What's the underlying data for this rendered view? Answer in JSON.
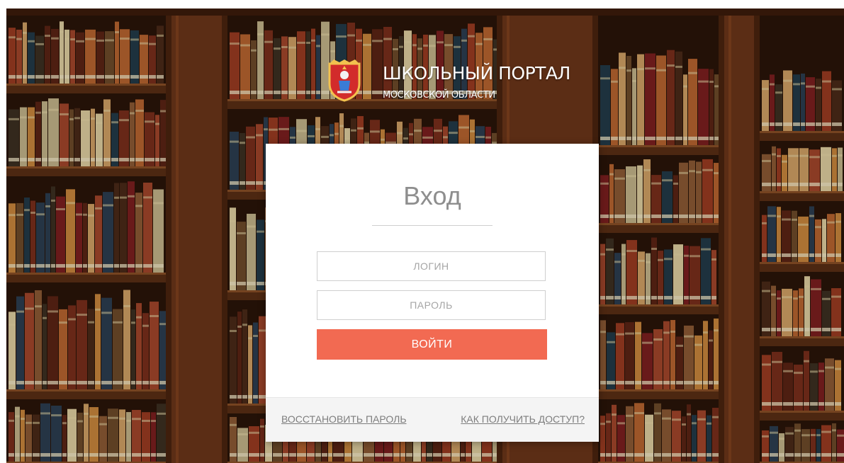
{
  "header": {
    "title": "ШКОЛЬНЫЙ ПОРТАЛ",
    "subtitle": "МОСКОВСКОЙ ОБЛАСТИ",
    "emblem_icon": "moscow-oblast-coat-of-arms"
  },
  "login": {
    "title": "Вход",
    "login_placeholder": "ЛОГИН",
    "login_value": "",
    "password_placeholder": "ПАРОЛЬ",
    "password_value": "",
    "submit_label": "ВОЙТИ"
  },
  "footer": {
    "restore_password_label": "ВОССТАНОВИТЬ ПАРОЛЬ",
    "get_access_label": "КАК ПОЛУЧИТЬ ДОСТУП?"
  },
  "colors": {
    "accent": "#f26a52",
    "card_background": "#ffffff",
    "footer_background": "#f4f4f4",
    "link_text": "#7d7d7d",
    "title_text": "#8e8e8e"
  }
}
